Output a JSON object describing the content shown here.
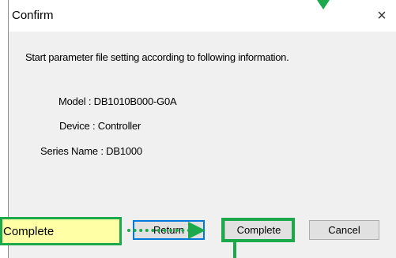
{
  "dialog": {
    "title": "Confirm",
    "close_glyph": "×",
    "message": "Start parameter file setting according to following information.",
    "info": {
      "model": "Model : DB1010B000-G0A",
      "device": "Device : Controller",
      "series": "Series Name : DB1000"
    },
    "buttons": {
      "return": "Return",
      "complete": "Complete",
      "cancel": "Cancel"
    }
  },
  "annotation": {
    "callout_label": "Complete",
    "accent_color": "#1ba94c",
    "callout_fill": "#ffffa6"
  }
}
